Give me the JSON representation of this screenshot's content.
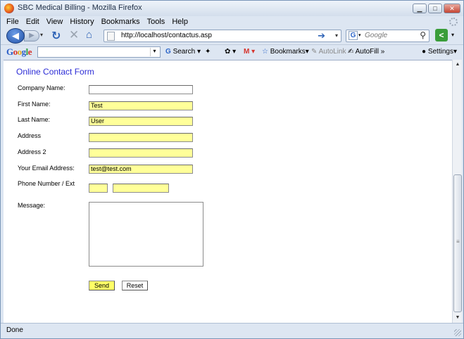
{
  "window": {
    "title": "SBC Medical Billing - Mozilla Firefox",
    "controls": {
      "minimize": "▁",
      "maximize": "□",
      "close": "✕"
    }
  },
  "menu": [
    "File",
    "Edit",
    "View",
    "History",
    "Bookmarks",
    "Tools",
    "Help"
  ],
  "nav": {
    "url": "http://localhost/contactus.asp",
    "search_engine_letter": "G",
    "search_placeholder": "Google"
  },
  "google_toolbar": {
    "logo": [
      "G",
      "o",
      "o",
      "g",
      "l",
      "e"
    ],
    "search_label": "Search",
    "bookmarks_label": "Bookmarks",
    "autolink_label": "AutoLink",
    "autofill_label": "AutoFill",
    "more_label": "»",
    "settings_label": "Settings"
  },
  "form": {
    "title": "Online Contact Form",
    "labels": {
      "company": "Company Name:",
      "first": "First Name:",
      "last": "Last Name:",
      "address": "Address",
      "address2": "Address 2",
      "email": "Your Email Address:",
      "phone": "Phone Number / Ext",
      "message": "Message:"
    },
    "values": {
      "company": "",
      "first": "Test",
      "last": "User",
      "address": "",
      "address2": "",
      "email": "test@test.com",
      "phone": "",
      "ext": "",
      "message": ""
    },
    "send_label": "Send",
    "reset_label": "Reset"
  },
  "status": {
    "text": "Done"
  },
  "colors": {
    "form_title": "#2c2cd6",
    "field_highlight": "#ffff99",
    "send_button": "#ffff66"
  }
}
